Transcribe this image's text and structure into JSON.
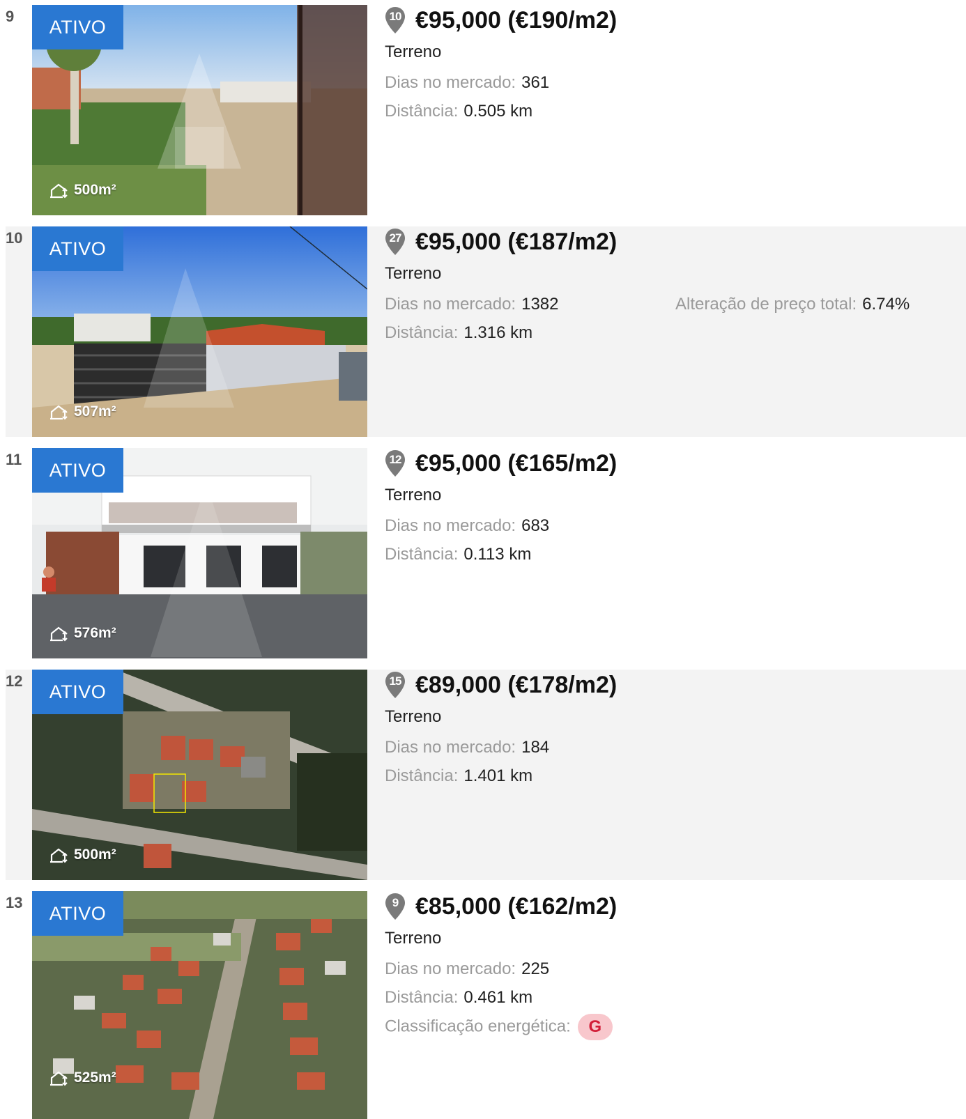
{
  "listings": [
    {
      "index": "9",
      "status": "ATIVO",
      "area": "500m²",
      "pin": "10",
      "price": "€95,000 (€190/m2)",
      "type": "Terreno",
      "days_label": "Dias no mercado:",
      "days": "361",
      "distance_label": "Distância:",
      "distance": "0.505 km"
    },
    {
      "index": "10",
      "status": "ATIVO",
      "area": "507m²",
      "pin": "27",
      "price": "€95,000 (€187/m2)",
      "type": "Terreno",
      "days_label": "Dias no mercado:",
      "days": "1382",
      "distance_label": "Distância:",
      "distance": "1.316 km",
      "price_change_label": "Alteração de preço total:",
      "price_change": "6.74%"
    },
    {
      "index": "11",
      "status": "ATIVO",
      "area": "576m²",
      "pin": "12",
      "price": "€95,000 (€165/m2)",
      "type": "Terreno",
      "days_label": "Dias no mercado:",
      "days": "683",
      "distance_label": "Distância:",
      "distance": "0.113 km"
    },
    {
      "index": "12",
      "status": "ATIVO",
      "area": "500m²",
      "pin": "15",
      "price": "€89,000 (€178/m2)",
      "type": "Terreno",
      "days_label": "Dias no mercado:",
      "days": "184",
      "distance_label": "Distância:",
      "distance": "1.401 km"
    },
    {
      "index": "13",
      "status": "ATIVO",
      "area": "525m²",
      "pin": "9",
      "price": "€85,000 (€162/m2)",
      "type": "Terreno",
      "days_label": "Dias no mercado:",
      "days": "225",
      "distance_label": "Distância:",
      "distance": "0.461 km",
      "energy_label": "Classificação energética:",
      "energy": "G"
    }
  ],
  "colors": {
    "status_badge": "#2a78d2",
    "shaded_row": "#f3f3f3",
    "pin": "#7a7a7a",
    "energy_badge_bg": "#f8c7cc",
    "energy_badge_text": "#d21e38"
  },
  "icons": {
    "map_pin": "map-pin-icon",
    "area": "land-area-icon"
  }
}
